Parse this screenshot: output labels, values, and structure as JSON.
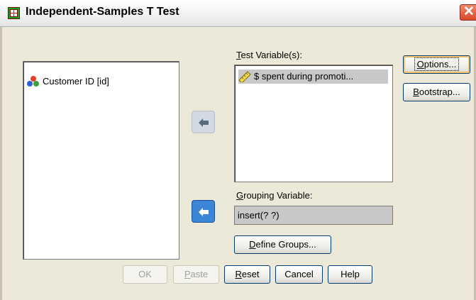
{
  "window": {
    "title": "Independent-Samples T Test",
    "close_glyph": "✕"
  },
  "source_list": {
    "items": [
      {
        "label": "Customer ID [id]",
        "icon": "nominal-variable-icon"
      }
    ]
  },
  "test_variables": {
    "label_underline": "T",
    "label_rest": "est Variable(s):",
    "items": [
      {
        "label": "$ spent during promoti...",
        "icon": "scale-variable-icon"
      }
    ]
  },
  "grouping": {
    "label_underline": "G",
    "label_rest": "rouping Variable:",
    "value": "insert(? ?)"
  },
  "side_buttons": {
    "options": {
      "underline": "O",
      "rest": "ptions..."
    },
    "bootstrap": {
      "underline": "B",
      "rest": "ootstrap..."
    }
  },
  "define_groups": {
    "underline": "D",
    "rest": "efine Groups..."
  },
  "bottom_buttons": {
    "ok": "OK",
    "paste_underline": "P",
    "paste_rest": "aste",
    "reset_underline": "R",
    "reset_rest": "eset",
    "cancel": "Cancel",
    "help": "Help"
  },
  "colors": {
    "dialog_bg": "#ece9d8",
    "selected_item_bg": "#c8c8c8",
    "active_arrow": "#3b86d6",
    "inactive_arrow": "#d2d9e3"
  }
}
